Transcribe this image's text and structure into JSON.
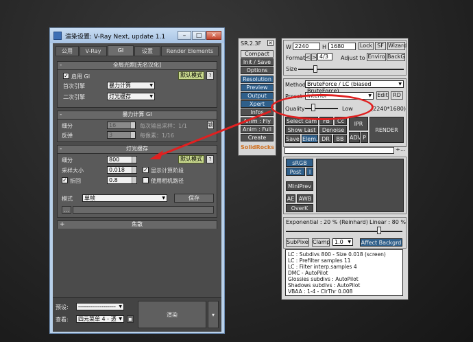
{
  "window": {
    "title": "渲染设置: V-Ray Next, update 1.1",
    "buttons": {
      "min": "–",
      "max": "□",
      "close": "✕"
    },
    "tabs": [
      "公用",
      "V-Ray",
      "GI",
      "设置",
      "Render Elements"
    ],
    "active_tab": "GI"
  },
  "gi": {
    "title": "全局光照[无名汉化]",
    "enable_label": "启用 GI",
    "enable_checked": true,
    "mode_button": "默认模式",
    "help": "?",
    "primary_label": "首次引擎",
    "primary_value": "暴力计算",
    "secondary_label": "二次引擎",
    "secondary_value": "灯光缓存"
  },
  "brute": {
    "title": "暴力计算 GI",
    "subdivs_label": "细分",
    "subdivs_value": "16",
    "bounces_label": "反弹",
    "bounces_value": "3",
    "aa_sampling": "每次输出采样：1/1",
    "gi_rays": "每像素：1/16",
    "lock": "锁"
  },
  "lightcache": {
    "title": "灯光缓存",
    "subdivs_label": "细分",
    "subdivs_value": "800",
    "mode_button": "默认模式",
    "help": "?",
    "sample_label": "采样大小",
    "sample_value": "0.018",
    "show_calc": "显示计算阶段",
    "show_calc_checked": true,
    "retrace_label": "折回",
    "retrace_value": "0.8",
    "retrace_checked": true,
    "use_camera": "使用相机路径",
    "use_camera_checked": false,
    "mode_label": "模式",
    "mode_value": "单帧",
    "save_button": "保存",
    "browse": "..."
  },
  "caustics": {
    "title": "焦散"
  },
  "bottom": {
    "preset_label": "预设:",
    "preset_value": "-------------------",
    "view_label": "查看:",
    "view_value": "四元菜单 4 - 透",
    "render_button": "渲染"
  },
  "sr_toolbar": {
    "title": "SR.2.3F",
    "items": [
      {
        "label": "Compact UI",
        "style": "light"
      },
      {
        "label": "Init / Save",
        "style": "dark"
      },
      {
        "label": "Options",
        "style": "dark"
      },
      {
        "label": "Resolution",
        "style": "blue"
      },
      {
        "label": "Preview",
        "style": "blue"
      },
      {
        "label": "Output",
        "style": "blue"
      },
      {
        "label": "Xpert",
        "style": "blue"
      },
      {
        "label": "Infos",
        "style": "dark"
      },
      {
        "label": "Anim : Fly",
        "style": "dark"
      },
      {
        "label": "Anim : Full",
        "style": "dark"
      },
      {
        "label": "Create",
        "style": "dark"
      }
    ],
    "brand": "SolidRocks"
  },
  "sr_panel": {
    "w_label": "W",
    "width": "2240",
    "h_label": "H",
    "height": "1680",
    "lock": "Lock",
    "sf": "SF",
    "wizard": "Wizard",
    "format_label": "Format",
    "format_value": "4/3",
    "adjust_label": "Adjust to",
    "enviro": "Enviro",
    "backg": "BackG",
    "size_label": "Size",
    "method_label": "Method",
    "method_value": "BruteForce / LC (biased BruteForce)",
    "preset_label": "Preset",
    "preset_value": "Interior",
    "edit": "Edit",
    "rd": "RD",
    "quality_label": "Quality",
    "quality_value": "Low",
    "resolution_readout": "(2240*1680)",
    "quality_level": 0.25,
    "select_cam": "Select cam",
    "show_last": "Show Last",
    "denoise": "Denoise",
    "save": "Save",
    "elem": "Elem.",
    "dr": "DR",
    "bb": "BB",
    "ipr": "IPR",
    "adv": "ADV",
    "p": "P",
    "render": "RENDER",
    "plus": "+",
    "dots": "...",
    "srgb": "sRGB",
    "post": "Post",
    "i": "I",
    "miniprev": "MiniPrev",
    "ae": "AE",
    "awb": "AWB",
    "overk": "OverK",
    "exposure_text": "Exponential : 20 %  (Reinhard)",
    "linear_text": "Linear : 80 %",
    "exposure_level": 0.8,
    "subpixel": "SubPixel",
    "clamp": "Clamp",
    "clamp_value": "1.0",
    "affect": "Affect Backgrd",
    "log": [
      "LC : Subdivs 800 - Size 0.018 (screen)",
      "LC : Prefilter samples 11",
      "LC : Filter interp.samples  4",
      "DMC - AutoPilot",
      "Glossies subdivs : AutoPilot",
      "Shadows subdivs : AutoPilot",
      "VBAA : 1-4 - ClrThr 0.008"
    ]
  },
  "colors": {
    "annotation": "#e02020",
    "accent": "#2f5f8a"
  }
}
